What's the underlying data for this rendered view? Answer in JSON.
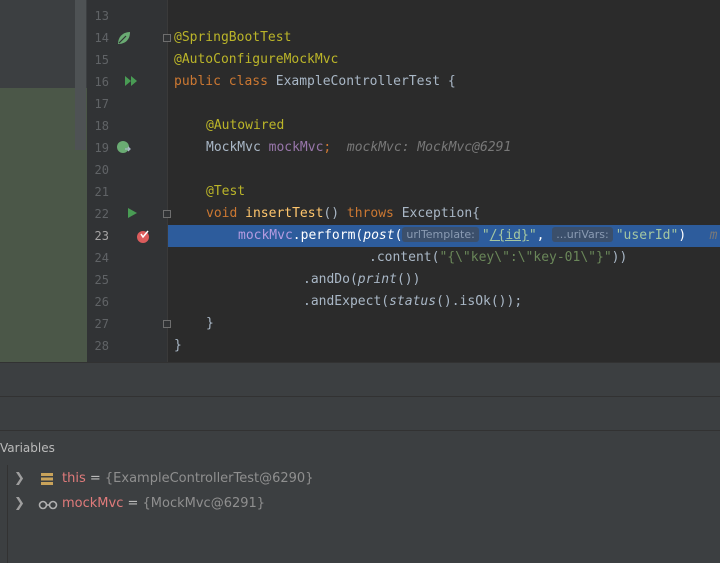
{
  "editor": {
    "lines": [
      {
        "num": "13"
      },
      {
        "num": "14",
        "a1": "@SpringBootTest"
      },
      {
        "num": "15",
        "a1": "@AutoConfigureMockMvc"
      },
      {
        "num": "16",
        "kw1": "public class",
        "t1": " ExampleControllerTest {"
      },
      {
        "num": "17"
      },
      {
        "num": "18",
        "a1": "@Autowired"
      },
      {
        "num": "19",
        "t1": "MockMvc ",
        "f1": "mockMvc",
        "p1": ";",
        "inlay": "mockMvc: MockMvc@6291"
      },
      {
        "num": "20"
      },
      {
        "num": "21",
        "a1": "@Test"
      },
      {
        "num": "22",
        "kw1": "void",
        "fn1": "insertTest",
        "t1": "() ",
        "kw2": "throws",
        "t2": " Exception{"
      },
      {
        "num": "23",
        "f1": "mockMvc",
        "t1": ".perform(",
        "i1": "post",
        "t2": "(",
        "hint1": "urlTemplate:",
        "s1": "\"",
        "s1u": "/{id}",
        "s1e": "\"",
        "t3": ", ",
        "hint2": "...uriVars:",
        "s2": "\"userId\"",
        "t4": ")   ",
        "tail": "m"
      },
      {
        "num": "24",
        "t1": ".content(",
        "s1": "\"{\\\"key\\\":\\\"key-01\\\"}\"",
        "t2": "))"
      },
      {
        "num": "25",
        "t1": ".andDo(",
        "i1": "print",
        "t2": "())"
      },
      {
        "num": "26",
        "t1": ".andExpect(",
        "i1": "status",
        "t2": "().isOk());"
      },
      {
        "num": "27",
        "t1": "}"
      },
      {
        "num": "28",
        "t1": "}"
      }
    ]
  },
  "variables": {
    "header": "Variables",
    "items": [
      {
        "name": "this",
        "eq": " = ",
        "value": "{ExampleControllerTest@6290}",
        "icon": "field-stack-icon"
      },
      {
        "name": "mockMvc",
        "eq": " = ",
        "value": "{MockMvc@6291}",
        "icon": "watch-glasses-icon"
      }
    ]
  },
  "colors": {
    "background": "#2b2b2b",
    "gutter": "#313335",
    "current_line": "#2d5c9c",
    "annotation": "#bbb529",
    "keyword": "#cc7832",
    "field": "#9876aa",
    "string": "#6a8759"
  }
}
